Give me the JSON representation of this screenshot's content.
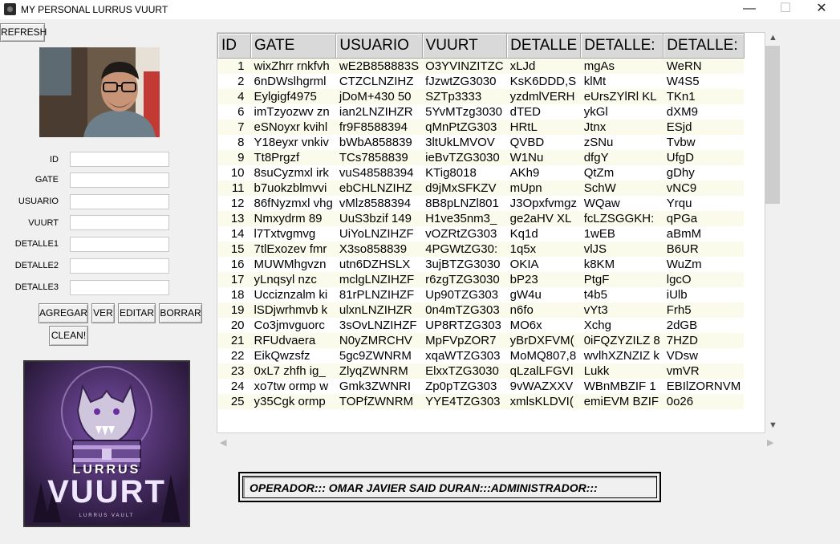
{
  "window": {
    "title": "MY PERSONAL LURRUS VUURT",
    "minimize": "—",
    "maximize": "☐",
    "close": "✕"
  },
  "toolbar": {
    "refresh_label": "REFRESH"
  },
  "form": {
    "fields": [
      {
        "label": "ID",
        "value": ""
      },
      {
        "label": "GATE",
        "value": ""
      },
      {
        "label": "USUARIO",
        "value": ""
      },
      {
        "label": "VUURT",
        "value": ""
      },
      {
        "label": "DETALLE1",
        "value": ""
      },
      {
        "label": "DETALLE2",
        "value": ""
      },
      {
        "label": "DETALLE3",
        "value": ""
      }
    ],
    "buttons": {
      "agregar": "AGREGAR",
      "ver": "VER",
      "editar": "EDITAR",
      "borrar": "BORRAR",
      "clean": "CLEAN!"
    }
  },
  "table": {
    "columns": [
      "ID",
      "GATE",
      "USUARIO",
      "VUURT",
      "DETALLE",
      "DETALLE:",
      "DETALLE:"
    ],
    "rows": [
      [
        "1",
        "wixZhrr rnkfvh",
        "wE2B858883S",
        "O3YVINZITZC",
        "xLJd",
        "mgAs",
        "WeRN"
      ],
      [
        "2",
        "6nDWslhgrml",
        "CTZCLNZIHZ",
        "fJzwtZG3030",
        "KsK6DDD,S",
        "klMt",
        "W4S5"
      ],
      [
        "4",
        "Eylgigf4975",
        "jDoM+430 50",
        "SZTp3333",
        "yzdmlVERH",
        "eUrsZYlRl KL",
        "TKn1"
      ],
      [
        "6",
        "imTzyozwv zn",
        "ian2LNZIHZR",
        "5YvMTzg3030",
        "dTED",
        "ykGl",
        "dXM9"
      ],
      [
        "7",
        "eSNoyxr kvihl",
        "fr9F8588394",
        "qMnPtZG303",
        "HRtL",
        "Jtnx",
        "ESjd"
      ],
      [
        "8",
        "Y18eyxr vnkiv",
        "bWbA858839",
        "3ltUkLMVOV",
        "QVBD",
        "zSNu",
        "Tvbw"
      ],
      [
        "9",
        "Tt8Prgzf",
        "TCs7858839",
        "ieBvTZG3030",
        "W1Nu",
        "dfgY",
        "UfgD"
      ],
      [
        "10",
        "8suCyzmxl irk",
        "vuS48588394",
        "KTig8018",
        "AKh9",
        "QtZm",
        "gDhy"
      ],
      [
        "11",
        "b7uokzblmvvi",
        "ebCHLNZIHZ",
        "d9jMxSFKZV",
        "mUpn",
        "SchW",
        "vNC9"
      ],
      [
        "12",
        "86fNyzmxl vhg",
        "vMlz8588394",
        "8B8pLNZl801",
        "J3Opxfvmgz",
        "WQaw",
        "Yrqu"
      ],
      [
        "13",
        "Nmxydrm 89",
        "UuS3bzif 149",
        "H1ve35nm3_",
        "ge2aHV XL",
        "fcLZSGGKH:",
        "qPGa"
      ],
      [
        "14",
        "l7Txtvgmvg",
        "UiYoLNZIHZF",
        "vOZRtZG303",
        "Kq1d",
        "1wEB",
        "aBmM"
      ],
      [
        "15",
        "7tlExozev fmr",
        "X3so858839",
        "4PGWtZG30:",
        "1q5x",
        "vlJS",
        "B6UR"
      ],
      [
        "16",
        "MUWMhgvzn",
        "utn6DZHSLX",
        "3ujBTZG3030",
        "OKIA",
        "k8KM",
        "WuZm"
      ],
      [
        "17",
        "yLnqsyl nzc",
        "mclgLNZIHZF",
        "r6zgTZG3030",
        "bP23",
        "PtgF",
        "lgcO"
      ],
      [
        "18",
        "Ucciznzalm ki",
        "81rPLNZIHZF",
        "Up90TZG303",
        "gW4u",
        "t4b5",
        "iUlb"
      ],
      [
        "19",
        "lSDjwrhmvb k",
        "ulxnLNZIHZR",
        "0n4mTZG303",
        "n6fo",
        "vYt3",
        "Frh5"
      ],
      [
        "20",
        "Co3jmvguorc",
        "3sOvLNZIHZF",
        "UP8RTZG303",
        "MO6x",
        "Xchg",
        "2dGB"
      ],
      [
        "21",
        "RFUdvaera",
        "N0yZMRCHV",
        "MpFVpZOR7",
        "yBrDXFVM(",
        "0iFQZYZILZ 8",
        "7HZD"
      ],
      [
        "22",
        "EikQwzsfz",
        "5gc9ZWNRM",
        "xqaWTZG303",
        "MoMQ807,8",
        "wvlhXZNZIZ k",
        "VDsw"
      ],
      [
        "23",
        "0xL7 zhfh ig_",
        "ZlyqZWNRM",
        "ElxxTZG3030",
        "qLzalLFGVI",
        "Lukk",
        "vmVR"
      ],
      [
        "24",
        "xo7tw ormp w",
        "Gmk3ZWNRI",
        "Zp0pTZG303",
        "9vWAZXXV",
        "WBnMBZIF 1",
        "EBIlZORNVM"
      ],
      [
        "25",
        "y35Cgk ormp",
        "TOPfZWNRM",
        "YYE4TZG303",
        "xmlsKLDVI(",
        "emiEVM BZIF",
        "0o26"
      ]
    ]
  },
  "status_bar": {
    "text": "OPERADOR::: OMAR JAVIER SAID DURAN:::ADMINISTRADOR:::"
  },
  "logo": {
    "title": "LURRUS",
    "subtitle": "VUURT",
    "tagline": "LURRUS VAULT"
  }
}
